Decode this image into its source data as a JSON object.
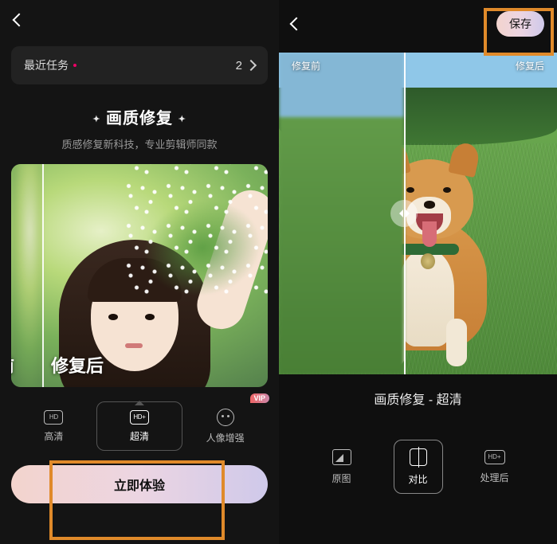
{
  "left": {
    "recent": {
      "label": "最近任务",
      "count": "2"
    },
    "title": "画质修复",
    "subtitle": "质感修复新科技，专业剪辑师同款",
    "preview": {
      "before_label": "前",
      "after_label": "修复后"
    },
    "modes": {
      "hd": {
        "label": "高清",
        "icon_text": "HD"
      },
      "hdplus": {
        "label": "超清",
        "icon_text": "HD+"
      },
      "portrait": {
        "label": "人像增强",
        "vip": "VIP"
      }
    },
    "cta": "立即体验"
  },
  "right": {
    "save": "保存",
    "top_labels": {
      "before": "修复前",
      "after": "修复后"
    },
    "caption": "画质修复 - 超清",
    "modes": {
      "original": {
        "label": "原图"
      },
      "compare": {
        "label": "对比"
      },
      "after": {
        "label": "处理后",
        "icon_text": "HD+"
      }
    }
  }
}
